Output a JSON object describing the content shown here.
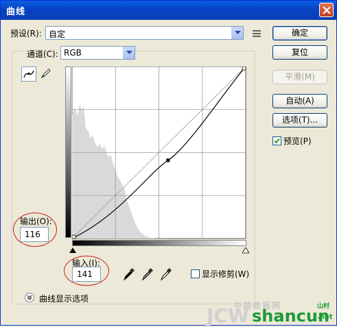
{
  "window": {
    "title": "曲线"
  },
  "preset": {
    "label": "预设(R):",
    "value": "自定"
  },
  "channel": {
    "label": "通道(C):",
    "value": "RGB"
  },
  "buttons": {
    "ok": "确定",
    "reset": "复位",
    "smooth": "平滑(M)",
    "auto": "自动(A)",
    "options": "选项(T)..."
  },
  "preview": {
    "label": "预览(P)",
    "checked": true
  },
  "output": {
    "label": "输出(O):",
    "value": "116"
  },
  "input": {
    "label": "输入(I):",
    "value": "141"
  },
  "clipping": {
    "label": "显示修剪(W)",
    "checked": false
  },
  "curve_display": {
    "label": "曲线显示选项"
  },
  "icons": {
    "curve_tool": "curve-point-icon",
    "pencil_tool": "pencil-icon",
    "preset_menu": "preset-options-icon",
    "black_eyedropper": "black-eyedropper-icon",
    "gray_eyedropper": "gray-eyedropper-icon",
    "white_eyedropper": "white-eyedropper-icon"
  },
  "curve": {
    "point": {
      "input": 141,
      "output": 116
    },
    "endpoints": [
      [
        0,
        0
      ],
      [
        255,
        255
      ]
    ]
  },
  "watermark": {
    "left": "JCW",
    "right": "shancun",
    "top": "中国教程网",
    "tag": "山村",
    "net": ".net"
  },
  "colors": {
    "title_bar": "#0842c4",
    "annotation": "#cc1d1d",
    "watermark_green": "#1d9a39"
  }
}
